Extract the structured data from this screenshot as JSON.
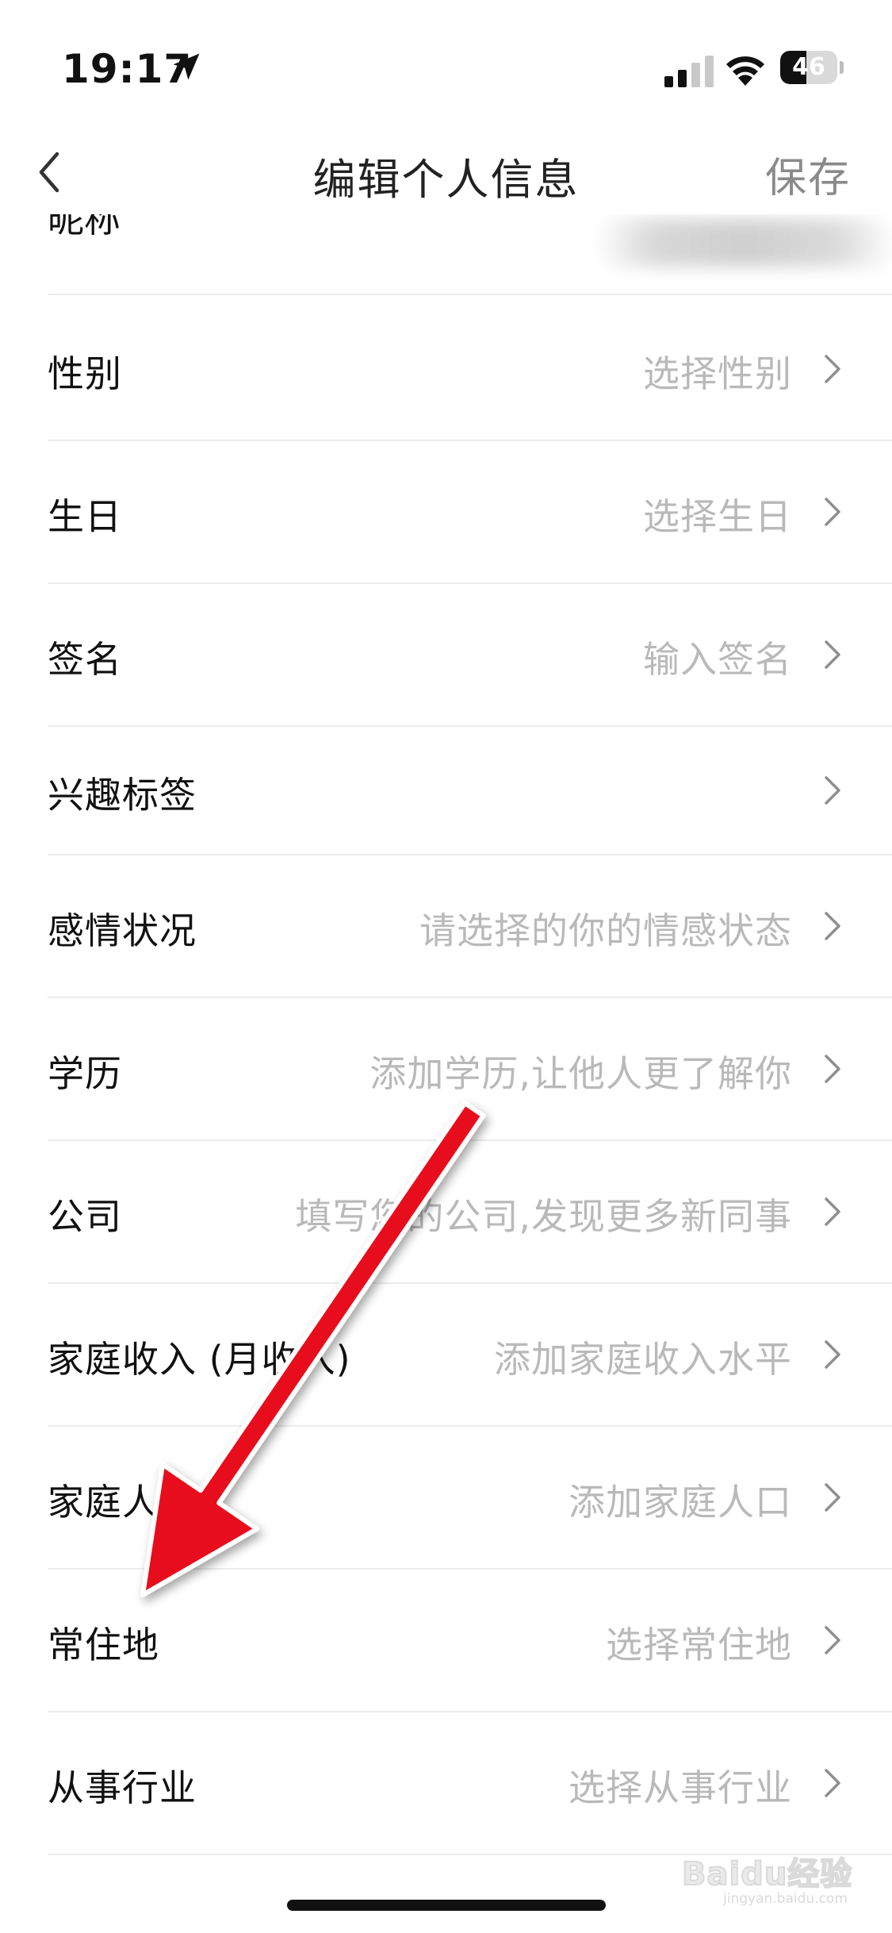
{
  "status_bar": {
    "time": "19:17",
    "battery_level": "46",
    "battery_fraction": 0.46
  },
  "nav": {
    "title": "编辑个人信息",
    "save_label": "保存"
  },
  "nickname_label": "昵称",
  "rows": [
    {
      "label": "性别",
      "value": "选择性别"
    },
    {
      "label": "生日",
      "value": "选择生日"
    },
    {
      "label": "签名",
      "value": "输入签名"
    },
    {
      "label": "兴趣标签",
      "value": ""
    },
    {
      "label": "感情状况",
      "value": "请选择的你的情感状态"
    },
    {
      "label": "学历",
      "value": "添加学历,让他人更了解你"
    },
    {
      "label": "公司",
      "value": "填写您的公司,发现更多新同事"
    },
    {
      "label": "家庭收入 (月收入)",
      "value": "添加家庭收入水平"
    },
    {
      "label": "家庭人口",
      "value": "添加家庭人口"
    },
    {
      "label": "常住地",
      "value": "选择常住地"
    },
    {
      "label": "从事行业",
      "value": "选择从事行业"
    }
  ],
  "icons": {
    "location": "location-arrow-icon",
    "signal": "cellular-signal-icon",
    "wifi": "wifi-icon",
    "battery": "battery-icon",
    "back": "chevron-left-icon",
    "row_chevron": "chevron-right-icon"
  },
  "colors": {
    "annotation_arrow": "#e8111a",
    "placeholder_text": "#b9b9b9",
    "divider": "#ececec"
  },
  "watermark": {
    "brand": "Baidu经验",
    "site": "jingyan.baidu.com"
  }
}
